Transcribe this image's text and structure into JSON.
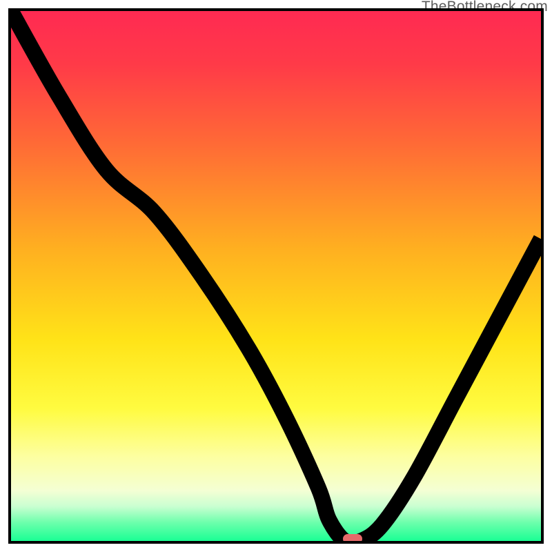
{
  "watermark": "TheBottleneck.com",
  "colors": {
    "frame": "#000000",
    "curve": "#000000",
    "marker": "#e76a6a",
    "gradient_stops": [
      {
        "offset": 0.0,
        "color": "#ff2a52"
      },
      {
        "offset": 0.1,
        "color": "#ff3a48"
      },
      {
        "offset": 0.25,
        "color": "#ff6a36"
      },
      {
        "offset": 0.45,
        "color": "#ffb020"
      },
      {
        "offset": 0.62,
        "color": "#ffe318"
      },
      {
        "offset": 0.75,
        "color": "#fffb40"
      },
      {
        "offset": 0.84,
        "color": "#fdffa0"
      },
      {
        "offset": 0.905,
        "color": "#f4ffd4"
      },
      {
        "offset": 0.935,
        "color": "#c9ffd1"
      },
      {
        "offset": 0.965,
        "color": "#6dffac"
      },
      {
        "offset": 1.0,
        "color": "#1aff94"
      }
    ]
  },
  "chart_data": {
    "type": "line",
    "title": "",
    "xlabel": "",
    "ylabel": "",
    "xlim": [
      0,
      100
    ],
    "ylim": [
      0,
      100
    ],
    "series": [
      {
        "name": "bottleneck-curve",
        "x": [
          0,
          9,
          18,
          27,
          36,
          45,
          52,
          58,
          60,
          63,
          66,
          70,
          76,
          84,
          92,
          100
        ],
        "values": [
          100,
          84,
          70,
          62,
          50,
          36,
          23,
          10,
          4,
          0,
          0,
          3,
          12,
          27,
          42,
          57
        ]
      }
    ],
    "minimum_marker": {
      "x": 64.5,
      "y": 0
    }
  }
}
